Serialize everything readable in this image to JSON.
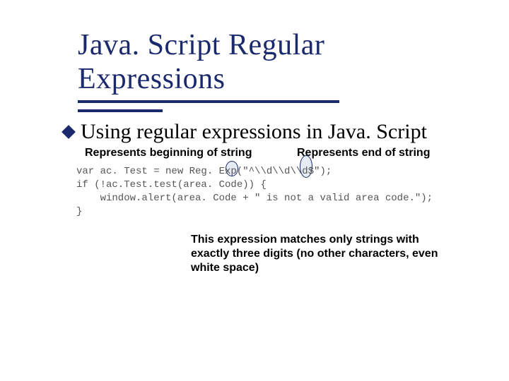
{
  "title": "Java. Script Regular Expressions",
  "bullet": "Using regular expressions in Java. Script",
  "labels": {
    "begin": "Represents beginning of string",
    "end": "Represents end of string"
  },
  "code": {
    "line1": "var ac. Test = new Reg. Exp(\"^\\\\d\\\\d\\\\d$\");",
    "line2": "if (!ac.Test.test(area. Code)) {",
    "line3": "    window.alert(area. Code + \" is not a valid area code.\");",
    "line4": "}"
  },
  "explanation": "This expression matches only strings with exactly three digits (no other characters, even white space)"
}
